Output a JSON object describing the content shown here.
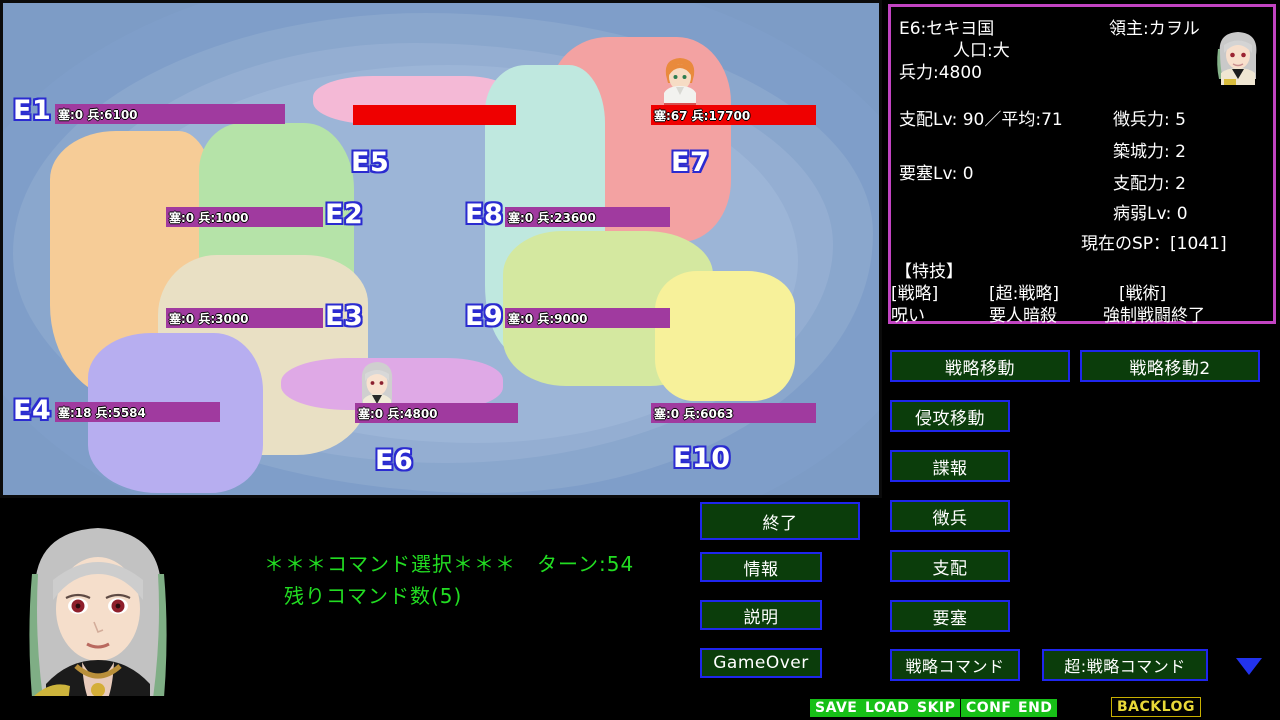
{
  "map": {
    "territories": [
      {
        "id": "E1",
        "label": "E1",
        "bar": "塞:0  兵:6100",
        "fort": 0,
        "troops": 6100,
        "color": "#f6cc97",
        "bar_style": "normal"
      },
      {
        "id": "E2",
        "label": "E2",
        "bar": "塞:0  兵:1000",
        "fort": 0,
        "troops": 1000,
        "color": "#b5e3a8",
        "bar_style": "normal"
      },
      {
        "id": "E3",
        "label": "E3",
        "bar": "塞:0  兵:3000",
        "fort": 0,
        "troops": 3000,
        "color": "#e9e0c4",
        "bar_style": "normal"
      },
      {
        "id": "E4",
        "label": "E4",
        "bar": "塞:18  兵:5584",
        "fort": 18,
        "troops": 5584,
        "color": "#b7aef0",
        "bar_style": "normal"
      },
      {
        "id": "E5",
        "label": "E5",
        "bar": "",
        "fort": null,
        "troops": null,
        "color": "#f4b9d6",
        "bar_style": "red"
      },
      {
        "id": "E6",
        "label": "E6",
        "bar": "塞:0  兵:4800",
        "fort": 0,
        "troops": 4800,
        "color": "#dfa9e6",
        "bar_style": "normal"
      },
      {
        "id": "E7",
        "label": "E7",
        "bar": "塞:67  兵:17700",
        "fort": 67,
        "troops": 17700,
        "color": "#f3a2a2",
        "bar_style": "red"
      },
      {
        "id": "E8",
        "label": "E8",
        "bar": "塞:0  兵:23600",
        "fort": 0,
        "troops": 23600,
        "color": "#bfe8df",
        "bar_style": "normal"
      },
      {
        "id": "E9",
        "label": "E9",
        "bar": "塞:0  兵:9000",
        "fort": 0,
        "troops": 9000,
        "color": "#d4e8a0",
        "bar_style": "normal"
      },
      {
        "id": "E10",
        "label": "E10",
        "bar": "塞:0  兵:6063",
        "fort": 0,
        "troops": 6063,
        "color": "#f7f19a",
        "bar_style": "normal"
      }
    ]
  },
  "info": {
    "region": "E6:セキヨ国",
    "lord": "領主:カヲル",
    "population": "人口:大",
    "troops": "兵力:4800",
    "rule_lv": "支配Lv: 90／平均:71",
    "fort_lv": "要塞Lv: 0",
    "conscript": "徴兵力: 5",
    "build": "築城力: 2",
    "rule_power": "支配力: 2",
    "sick_lv": "病弱Lv: 0",
    "sp": "現在のSP：[1041]",
    "skills_header": "【特技】",
    "skill_cat_1": "[戦略]",
    "skill_cat_2": "[超:戦略]",
    "skill_cat_3": "[戦術]",
    "skill_1": "呪い",
    "skill_2": "要人暗殺",
    "skill_3": "強制戦闘終了",
    "border_color": "#c244c2"
  },
  "commands": {
    "strategic_move": "戦略移動",
    "strategic_move2": "戦略移動2",
    "invade_move": "侵攻移動",
    "intel": "諜報",
    "conscript": "徴兵",
    "rule": "支配",
    "fortress": "要塞",
    "strategy_command": "戦略コマンド",
    "super_strategy_command": "超:戦略コマンド",
    "end": "終了",
    "info": "情報",
    "help": "説明",
    "gameover": "GameOver"
  },
  "message": {
    "line1": "＊＊＊コマンド選択＊＊＊　ターン:54",
    "line2": "残りコマンド数(5)",
    "turn": 54,
    "remaining_commands": 5,
    "color": "#22dd22"
  },
  "sysbar": {
    "save": "SAVE",
    "load": "LOAD",
    "skip": "SKIP",
    "conf": "CONF",
    "end": "END",
    "backlog": "BACKLOG"
  }
}
